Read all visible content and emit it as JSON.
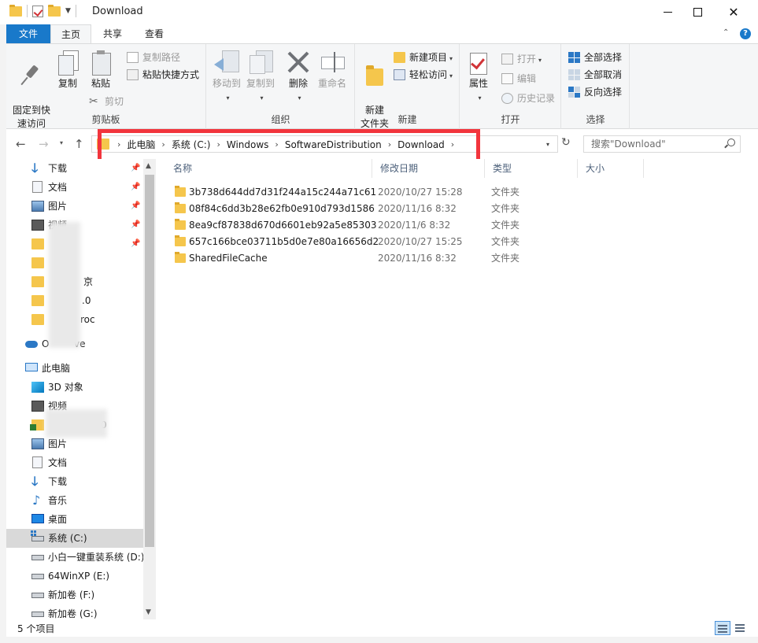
{
  "window": {
    "title": "Download",
    "minimize_glyph": "",
    "close_glyph": "✕"
  },
  "tabs": [
    "文件",
    "主页",
    "共享",
    "查看"
  ],
  "ribbon": {
    "clipboard": {
      "label": "剪贴板",
      "pin_quick": "固定到快\n速访问",
      "copy": "复制",
      "paste": "粘贴",
      "copy_path": "复制路径",
      "paste_shortcut": "粘贴快捷方式",
      "cut": "剪切"
    },
    "organize": {
      "label": "组织",
      "move_to": "移动到",
      "copy_to": "复制到",
      "delete": "删除",
      "rename": "重命名"
    },
    "new": {
      "label": "新建",
      "new_folder": "新建\n文件夹",
      "new_item": "新建项目",
      "easy_access": "轻松访问"
    },
    "open": {
      "label": "打开",
      "properties": "属性",
      "open": "打开",
      "edit": "编辑",
      "history": "历史记录"
    },
    "select": {
      "label": "选择",
      "select_all": "全部选择",
      "select_none": "全部取消",
      "invert": "反向选择"
    }
  },
  "address": {
    "crumbs": [
      "此电脑",
      "系统 (C:)",
      "Windows",
      "SoftwareDistribution",
      "Download"
    ],
    "search_placeholder": "搜索\"Download\""
  },
  "nav": {
    "quick_access": [
      {
        "label": "下载",
        "icon": "download-arrow-icon",
        "pinned": true
      },
      {
        "label": "文档",
        "icon": "document-icon",
        "pinned": true
      },
      {
        "label": "图片",
        "icon": "pictures-icon",
        "pinned": true
      },
      {
        "label": "视频",
        "icon": "video-icon",
        "pinned": true
      },
      {
        "label": "",
        "icon": "folder-icon",
        "pinned": true
      },
      {
        "label": "",
        "icon": "folder-icon",
        "pinned": false
      },
      {
        "label": "京",
        "icon": "folder-icon",
        "pinned": false
      },
      {
        "label": ".0",
        "icon": "folder-icon",
        "pinned": false
      },
      {
        "label": "roc",
        "icon": "folder-icon",
        "pinned": false
      }
    ],
    "onedrive": {
      "label_start": "O",
      "label_end": "ve"
    },
    "this_pc": "此电脑",
    "pc_items": [
      {
        "label": "3D 对象",
        "icon": "3d-objects-icon"
      },
      {
        "label": "视频",
        "icon": "video-icon"
      },
      {
        "label": "0",
        "icon": "folder-download-icon"
      },
      {
        "label": "图片",
        "icon": "pictures-icon"
      },
      {
        "label": "文档",
        "icon": "document-icon"
      },
      {
        "label": "下载",
        "icon": "download-arrow-icon"
      },
      {
        "label": "音乐",
        "icon": "music-icon"
      },
      {
        "label": "桌面",
        "icon": "desktop-icon"
      },
      {
        "label": "系统 (C:)",
        "icon": "windows-drive-icon",
        "selected": true
      },
      {
        "label": "小白一键重装系统 (D:)",
        "icon": "drive-icon"
      },
      {
        "label": "64WinXP  (E:)",
        "icon": "drive-icon"
      },
      {
        "label": "新加卷 (F:)",
        "icon": "drive-icon"
      },
      {
        "label": "新加卷 (G:)",
        "icon": "drive-icon"
      }
    ]
  },
  "columns": [
    "名称",
    "修改日期",
    "类型",
    "大小"
  ],
  "files": [
    {
      "name": "3b738d644dd7d31f244a15c244a71c61",
      "date": "2020/10/27 15:28",
      "type": "文件夹"
    },
    {
      "name": "08f84c6dd3b28e62fb0e910d793d1586",
      "date": "2020/11/16 8:32",
      "type": "文件夹"
    },
    {
      "name": "8ea9cf87838d670d6601eb92a5e85303",
      "date": "2020/11/6 8:32",
      "type": "文件夹"
    },
    {
      "name": "657c166bce03711b5d0e7e80a16656d2",
      "date": "2020/10/27 15:25",
      "type": "文件夹"
    },
    {
      "name": "SharedFileCache",
      "date": "2020/11/16 8:32",
      "type": "文件夹"
    }
  ],
  "status": {
    "count": "5 个项目"
  },
  "colors": {
    "accent": "#1979ca",
    "folder": "#f5c64c",
    "highlight_box": "#f2353d"
  }
}
